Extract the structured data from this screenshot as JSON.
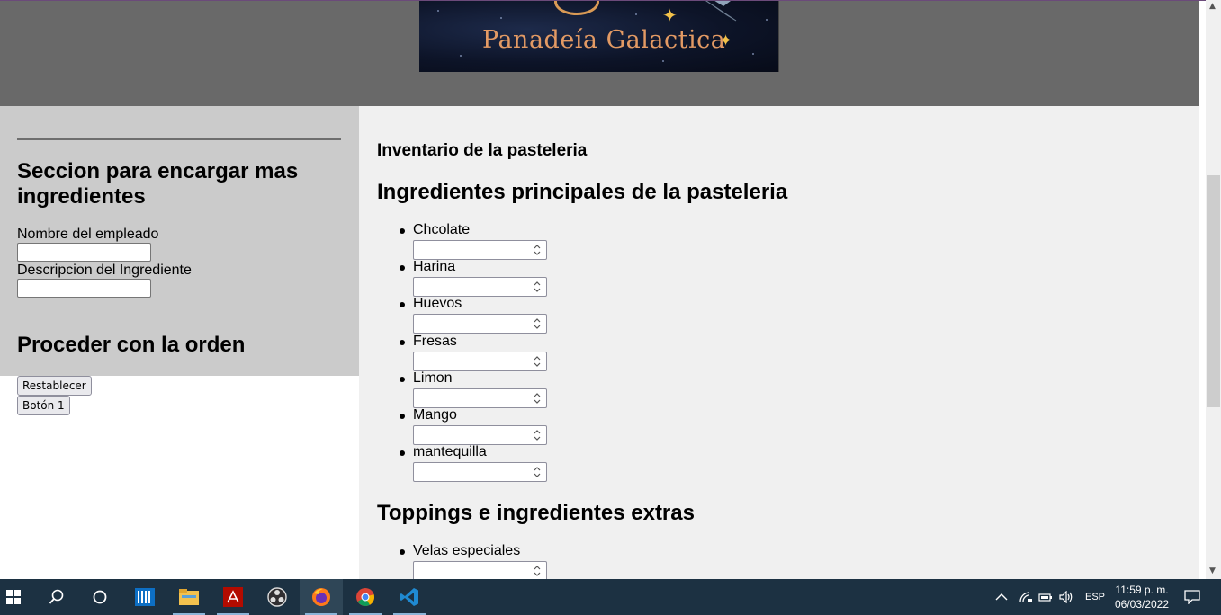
{
  "banner": {
    "title": "Panadeía Galactica"
  },
  "sidebar": {
    "section_title": "Seccion para encargar mas ingredientes",
    "employee_label": "Nombre del empleado",
    "employee_value": "",
    "ingredient_label": "Descripcion del Ingrediente",
    "ingredient_value": "",
    "order_title": "Proceder con la orden",
    "reset_button": "Restablecer",
    "button1": "Botón 1"
  },
  "main": {
    "inventory_title": "Inventario de la pasteleria",
    "main_ingredients_title": "Ingredientes principales de la pasteleria",
    "ingredients": [
      {
        "name": "Chcolate",
        "value": ""
      },
      {
        "name": "Harina",
        "value": ""
      },
      {
        "name": "Huevos",
        "value": ""
      },
      {
        "name": "Fresas",
        "value": ""
      },
      {
        "name": "Limon",
        "value": ""
      },
      {
        "name": "Mango",
        "value": ""
      },
      {
        "name": "mantequilla",
        "value": ""
      }
    ],
    "toppings_title": "Toppings e ingredientes extras",
    "toppings": [
      {
        "name": "Velas especiales",
        "value": ""
      }
    ]
  },
  "taskbar": {
    "apps": [
      "start-icon",
      "search-icon",
      "cortana-icon",
      "columns-app-icon",
      "file-explorer-icon",
      "acrobat-icon",
      "obs-icon",
      "firefox-icon",
      "chrome-icon",
      "vscode-icon"
    ],
    "active_app": "firefox-icon",
    "language": "ESP",
    "time": "11:59 p. m.",
    "date": "06/03/2022"
  },
  "colors": {
    "header_bg": "#696969",
    "sidebar_bg": "#cbcbcb",
    "main_bg": "#f0f0f0",
    "taskbar_bg": "#1c3142",
    "banner_text": "#e39a64"
  }
}
